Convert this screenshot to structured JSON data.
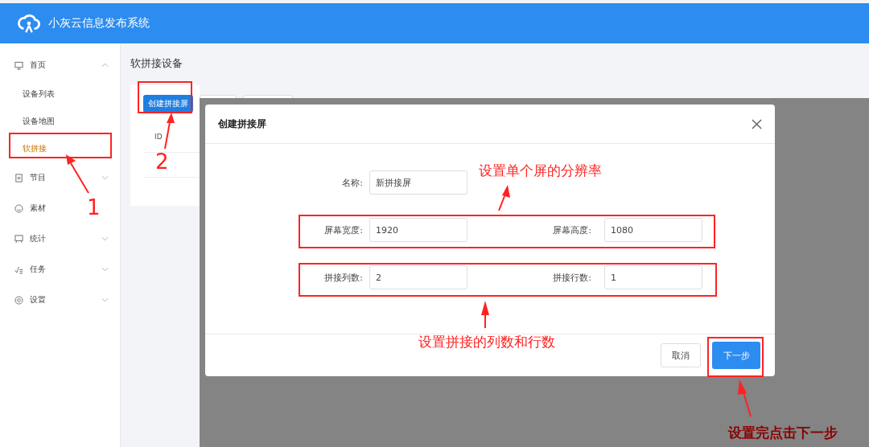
{
  "header": {
    "title": "小灰云信息发布系统"
  },
  "sidebar": {
    "items": [
      {
        "label": "首页",
        "expanded": true,
        "children": [
          {
            "label": "设备列表",
            "selected": false
          },
          {
            "label": "设备地图",
            "selected": false
          },
          {
            "label": "软拼接",
            "selected": true
          }
        ]
      },
      {
        "label": "节目",
        "expanded": false
      },
      {
        "label": "素材"
      },
      {
        "label": "统计",
        "expanded": false
      },
      {
        "label": "任务",
        "expanded": false
      },
      {
        "label": "设置",
        "expanded": false
      }
    ]
  },
  "page": {
    "title": "软拼接设备",
    "create_button": "创建拼接屏",
    "table": {
      "columns": [
        "ID"
      ]
    }
  },
  "dialog": {
    "title": "创建拼接屏",
    "rows": [
      [
        {
          "label": "名称:",
          "value": "新拼接屏"
        }
      ],
      [
        {
          "label": "屏幕宽度:",
          "value": "1920"
        },
        {
          "label": "屏幕高度:",
          "value": "1080"
        }
      ],
      [
        {
          "label": "拼接列数:",
          "value": "2"
        },
        {
          "label": "拼接行数:",
          "value": "1"
        }
      ]
    ],
    "cancel_button": "取消",
    "next_button": "下一步"
  },
  "annotations": {
    "step_numbers": [
      "1",
      "2"
    ],
    "notes": [
      "设置单个屏的分辨率",
      "设置拼接的列数和行数",
      "设置完点击下一步"
    ]
  }
}
